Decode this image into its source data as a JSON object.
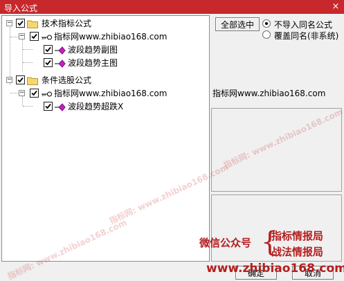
{
  "window": {
    "title": "导入公式",
    "close_glyph": "×"
  },
  "tree": {
    "groups": [
      {
        "label": "技术指标公式",
        "expander": "−",
        "source": {
          "label": "指标网www.zhibiao168.com",
          "expander": "−",
          "items": [
            {
              "label": "波段趋势副图"
            },
            {
              "label": "波段趋势主图"
            }
          ]
        }
      },
      {
        "label": "条件选股公式",
        "expander": "−",
        "source": {
          "label": "指标网www.zhibiao168.com",
          "expander": "−",
          "items": [
            {
              "label": "波段趋势超跌X"
            }
          ]
        }
      }
    ]
  },
  "options": {
    "select_all_label": "全部选中",
    "radio_no_import": "不导入同名公式",
    "radio_overwrite": "覆盖同名(非系统)",
    "selected": "no_import"
  },
  "info": {
    "source_text": "指标网www.zhibiao168.com"
  },
  "promo": {
    "wechat_label": "微信公众号",
    "brace": "{",
    "account_1": "指标情报局",
    "account_2": "战法情报局",
    "url": "www.zhibiao168.com"
  },
  "footer": {
    "import_label": "确定",
    "cancel_label": "取消"
  },
  "watermark": {
    "text": "指标网: www.zhibiao168.com"
  },
  "colors": {
    "titlebar": "#c7282c",
    "promo": "#b41e1e",
    "folder": "#f5d76e",
    "formula": "#c81ec8"
  }
}
